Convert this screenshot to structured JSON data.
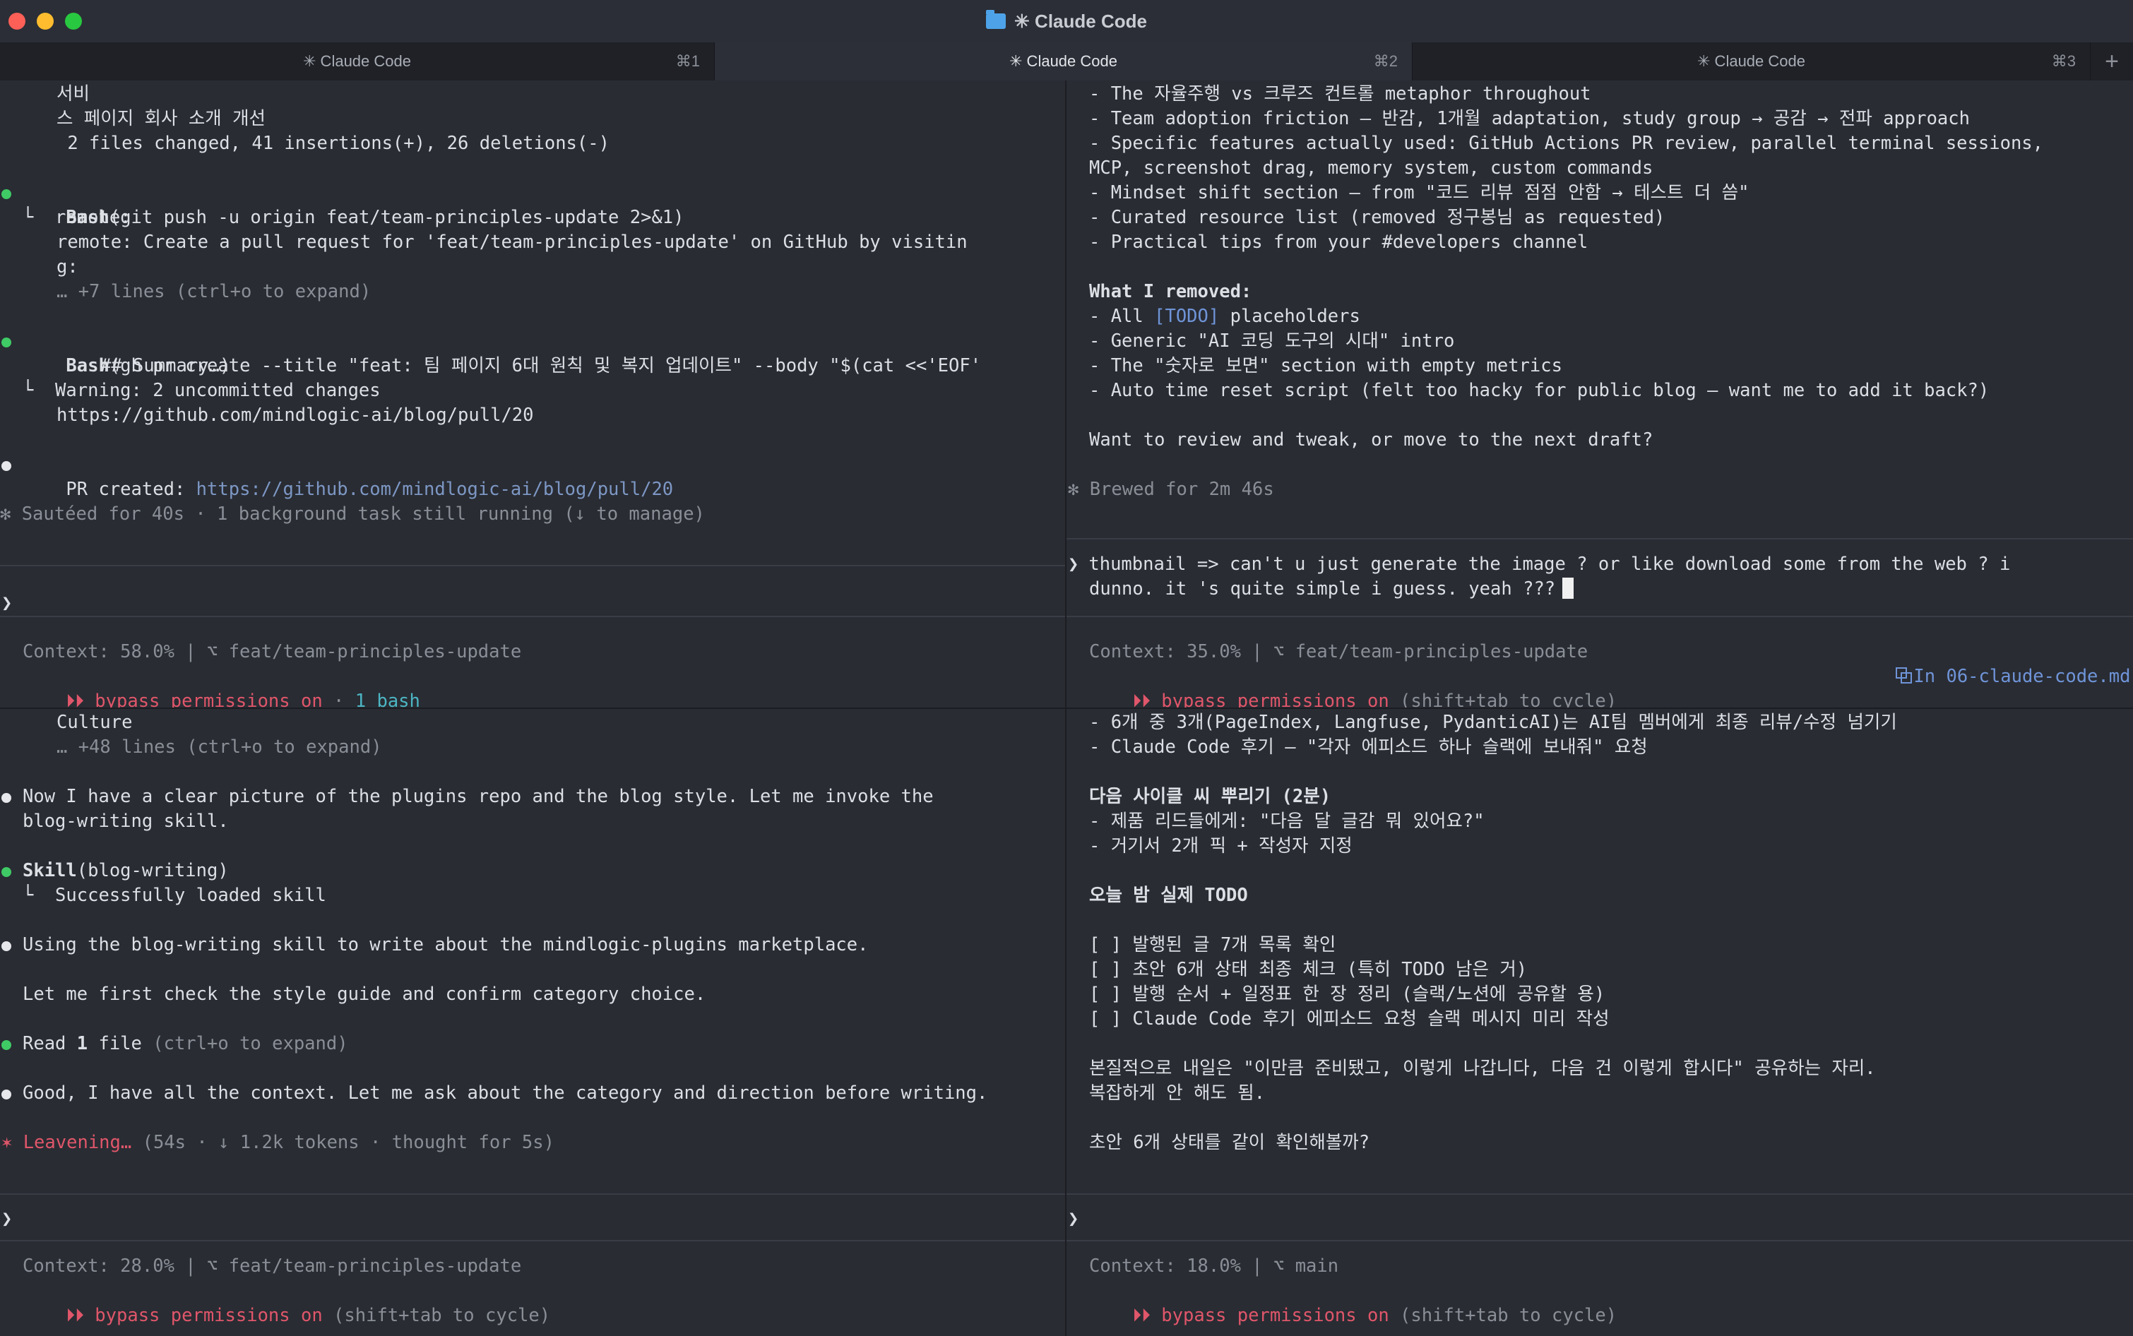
{
  "window": {
    "title": "✳ Claude Code"
  },
  "tabs": [
    {
      "label": "✳ Claude Code",
      "shortcut": "⌘1"
    },
    {
      "label": "✳ Claude Code",
      "shortcut": "⌘2"
    },
    {
      "label": "✳ Claude Code",
      "shortcut": "⌘3"
    }
  ],
  "tab_add": "+",
  "pane_tl": {
    "l1": "서비",
    "l2": "스 페이지 회사 소개 개선",
    "l3": " 2 files changed, 41 insertions(+), 26 deletions(-)",
    "b1_name": "Bash",
    "b1_args": "(git push -u origin feat/team-principles-update 2>&1)",
    "b1_o1": "└  remote:",
    "b1_o2": "remote: Create a pull request for 'feat/team-principles-update' on GitHub by visitin",
    "b1_o3": "g:",
    "b1_o4": "… +7 lines (ctrl+o to expand)",
    "b2_name": "Bash",
    "b2_args": "(gh pr create --title \"feat: 팀 페이지 6대 원칙 및 복지 업데이트\" --body \"$(cat <<'EOF'",
    "b2_args2": "## Summary…)",
    "b2_o1": "└  Warning: 2 uncommitted changes",
    "b2_o2": "https://github.com/mindlogic-ai/blog/pull/20",
    "pr_label": "PR created: ",
    "pr_url": "https://github.com/mindlogic-ai/blog/pull/20",
    "status": "✻ Sautéed for 40s · 1 background task still running (↓ to manage)",
    "prompt": "❯",
    "context": "Context: 58.0% | ⌥ feat/team-principles-update",
    "perm_arrows": "⏵⏵",
    "perm_text": " bypass permissions on",
    "perm_extra": " · ",
    "perm_bash": "1 bash"
  },
  "pane_tr": {
    "l1": "- The 자율주행 vs 크루즈 컨트롤 metaphor throughout",
    "l2": "- Team adoption friction — 반감, 1개월 adaptation, study group → 공감 → 전파 approach",
    "l3": "- Specific features actually used: GitHub Actions PR review, parallel terminal sessions,",
    "l4": "MCP, screenshot drag, memory system, custom commands",
    "l5": "- Mindset shift section — from \"코드 리뷰 점점 안함 → 테스트 더 씀\"",
    "l6": "- Curated resource list (removed 정구봉님 as requested)",
    "l7": "- Practical tips from your #developers channel",
    "removed_title": "What I removed:",
    "r1a": "- All ",
    "r1b": "[TODO]",
    "r1c": " placeholders",
    "r2": "- Generic \"AI 코딩 도구의 시대\" intro",
    "r3": "- The \"숫자로 보면\" section with empty metrics",
    "r4": "- Auto time reset script (felt too hacky for public blog — want me to add it back?)",
    "question": "Want to review and tweak, or move to the next draft?",
    "status": "✻ Brewed for 2m 46s",
    "prompt": "❯",
    "input1": "thumbnail => can't u just generate the image ? or like download some from the web ? i",
    "input2": "dunno. it 's quite simple i guess. yeah ???",
    "context": "Context: 35.0% | ⌥ feat/team-principles-update",
    "ide_ref": "In 06-claude-code.md",
    "perm_arrows": "⏵⏵",
    "perm_text": " bypass permissions on",
    "perm_extra": " (shift+tab to cycle)"
  },
  "pane_bl": {
    "l1": "Culture",
    "l2": "… +48 lines (ctrl+o to expand)",
    "m1a": "Now I have a clear picture of the plugins repo and the blog style. Let me invoke the",
    "m1b": "blog-writing skill.",
    "s_name": "Skill",
    "s_args": "(blog-writing)",
    "s_o1": "└  Successfully loaded skill",
    "m2": "Using the blog-writing skill to write about the mindlogic-plugins marketplace.",
    "m3": "Let me first check the style guide and confirm category choice.",
    "read_a": "Read ",
    "read_b": "1",
    "read_c": " file ",
    "read_d": "(ctrl+o to expand)",
    "m4": "Good, I have all the context. Let me ask about the category and direction before writing.",
    "status_a": "✶ Leavening… ",
    "status_b": "(54s · ↓ 1.2k tokens · thought for 5s)",
    "prompt": "❯",
    "context": "Context: 28.0% | ⌥ feat/team-principles-update",
    "perm_arrows": "⏵⏵",
    "perm_text": " bypass permissions on",
    "perm_extra": " (shift+tab to cycle)"
  },
  "pane_br": {
    "l1": "- 6개 중 3개(PageIndex, Langfuse, PydanticAI)는 AI팀 멤버에게 최종 리뷰/수정 넘기기",
    "l2": "- Claude Code 후기 — \"각자 에피소드 하나 슬랙에 보내줘\" 요청",
    "h1": "다음 사이클 씨 뿌리기 (2분)",
    "l3": "- 제품 리드들에게: \"다음 달 글감 뭐 있어요?\"",
    "l4": "- 거기서 2개 픽 + 작성자 지정",
    "h2": "오늘 밤 실제 TODO",
    "c1": "[ ] 발행된 글 7개 목록 확인",
    "c2": "[ ] 초안 6개 상태 최종 체크 (특히 TODO 남은 거)",
    "c3": "[ ] 발행 순서 + 일정표 한 장 정리 (슬랙/노션에 공유할 용)",
    "c4": "[ ] Claude Code 후기 에피소드 요청 슬랙 메시지 미리 작성",
    "p1": "본질적으로 내일은 \"이만큼 준비됐고, 이렇게 나갑니다, 다음 건 이렇게 합시다\" 공유하는 자리.",
    "p2": "복잡하게 안 해도 됨.",
    "q": "초안 6개 상태를 같이 확인해볼까?",
    "prompt": "❯",
    "context": "Context: 18.0% | ⌥ main",
    "perm_arrows": "⏵⏵",
    "perm_text": " bypass permissions on",
    "perm_extra": " (shift+tab to cycle)"
  }
}
